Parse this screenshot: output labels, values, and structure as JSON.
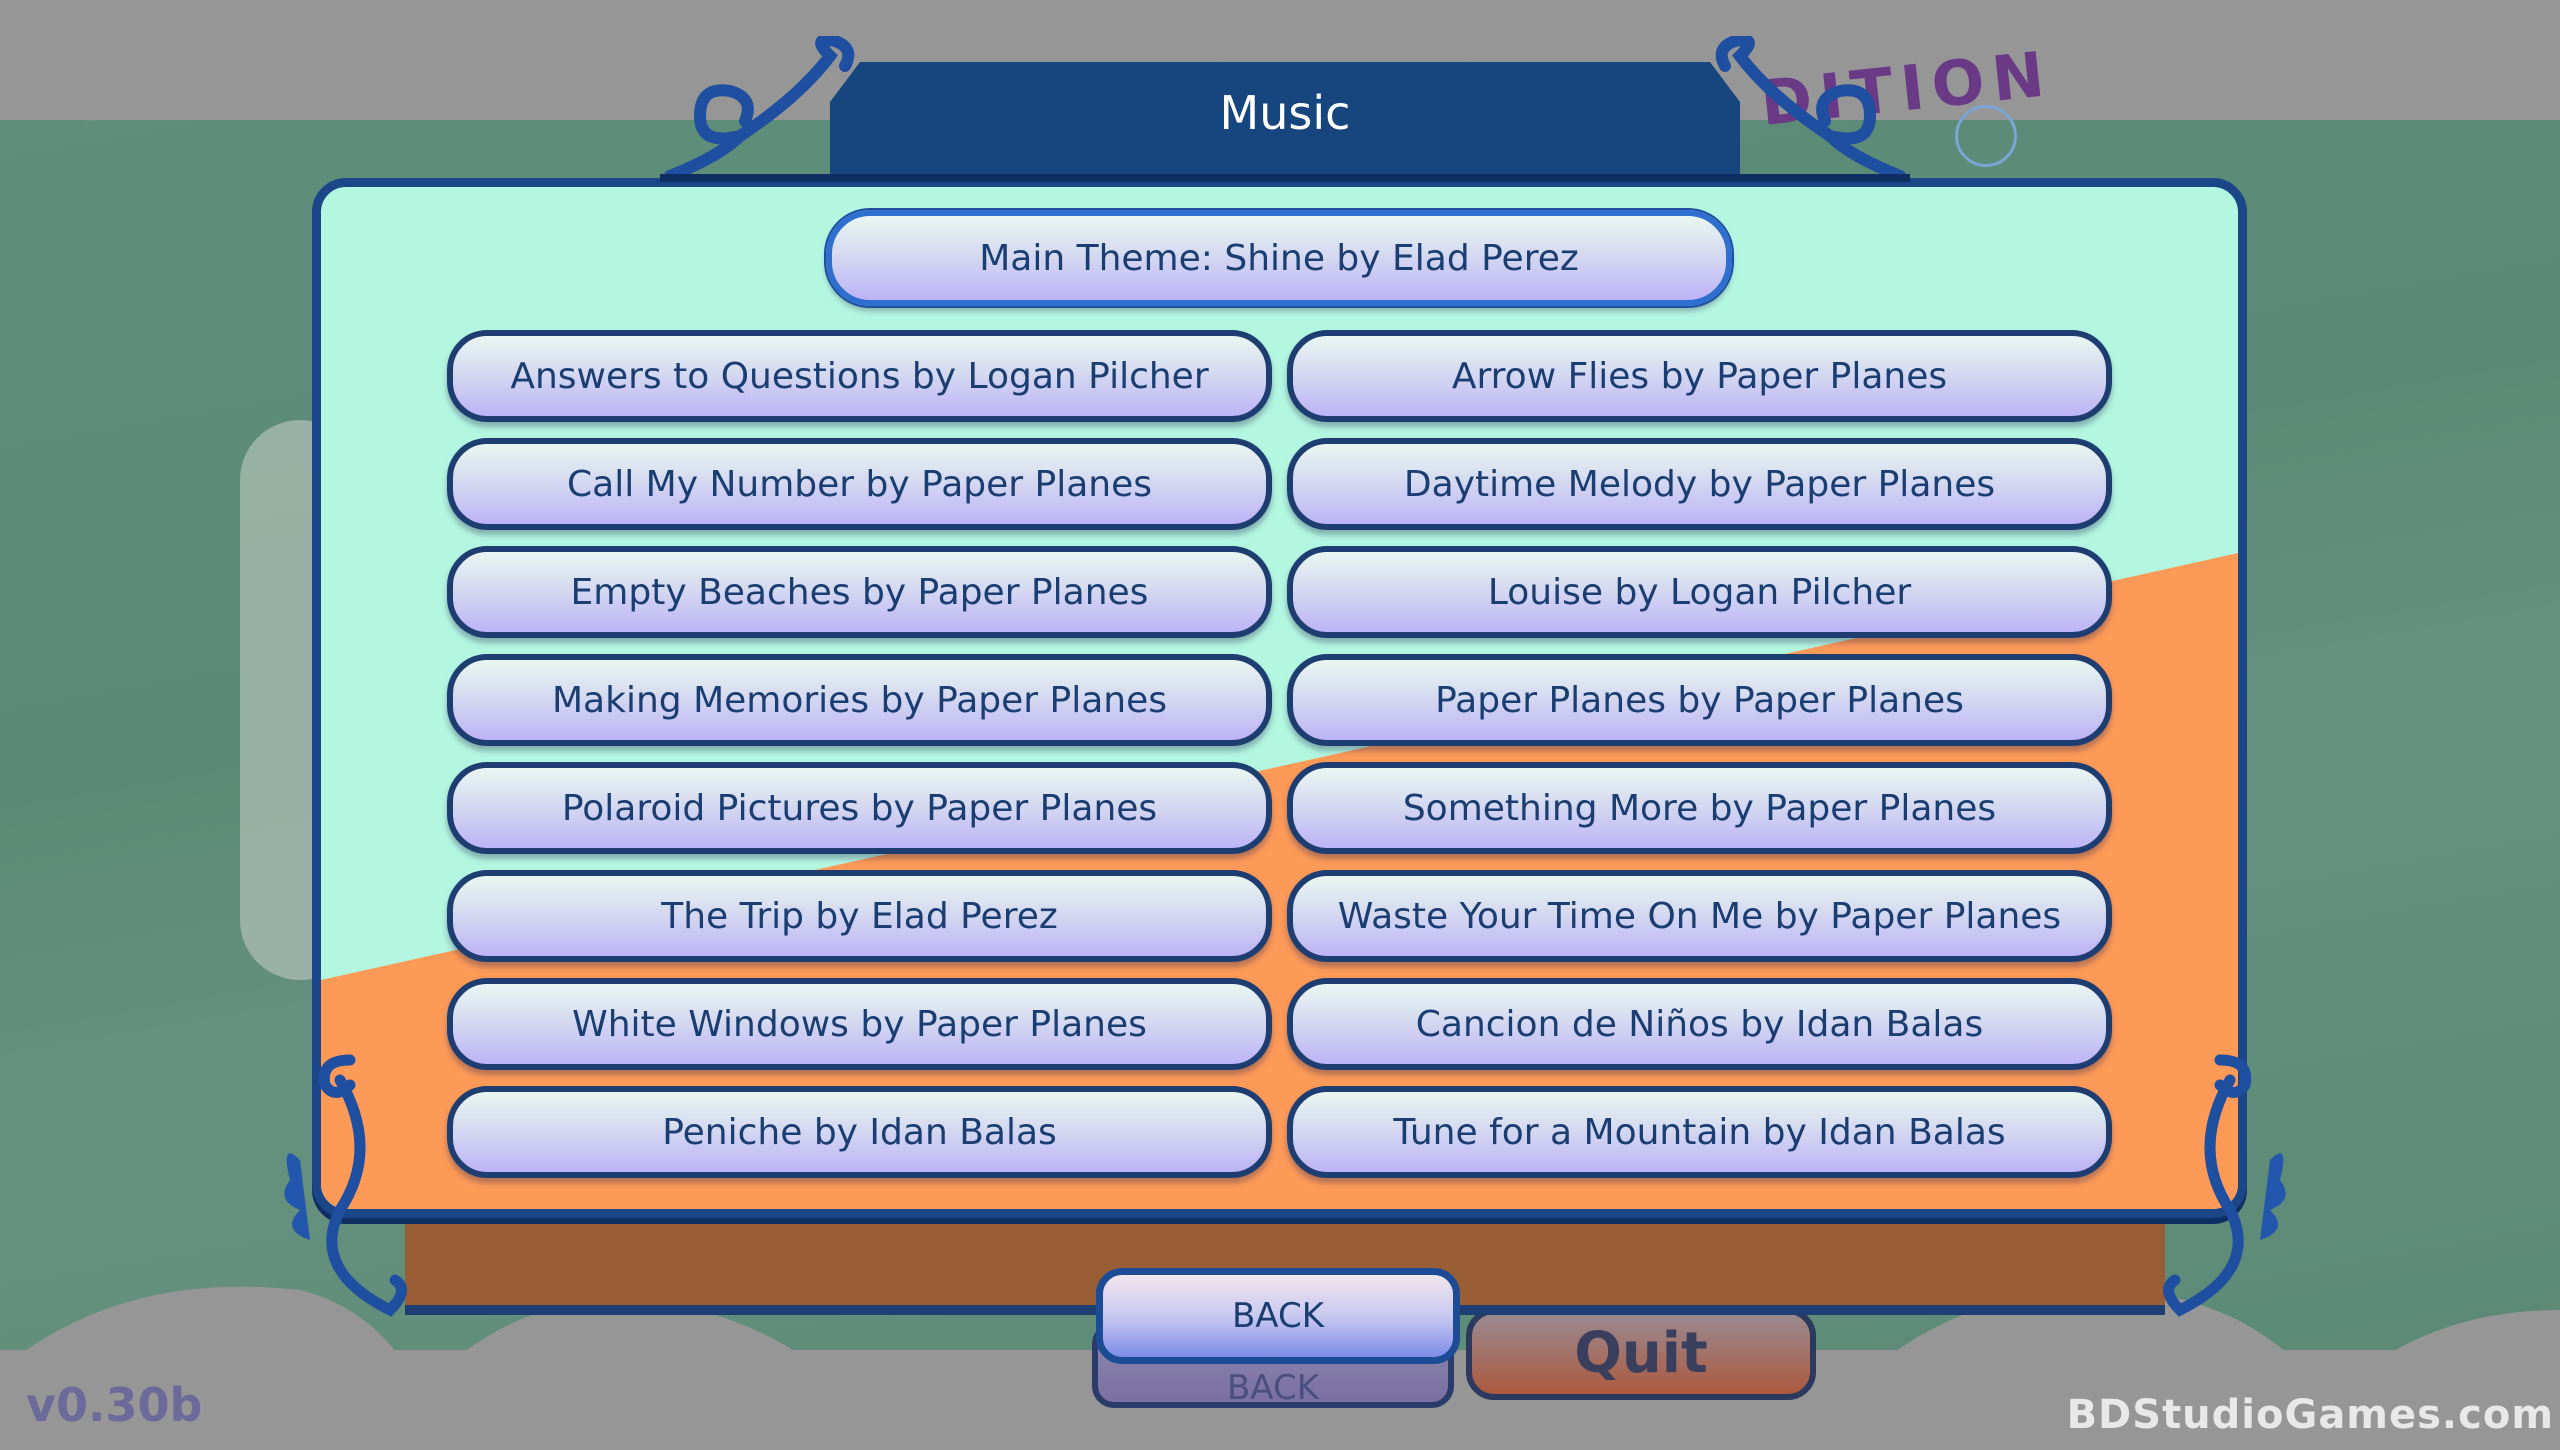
{
  "header": {
    "title": "Music"
  },
  "featured_track": {
    "label": "Main Theme: Shine by Elad Perez",
    "selected": true
  },
  "tracks": [
    {
      "label": "Answers to Questions by Logan Pilcher"
    },
    {
      "label": "Arrow Flies by Paper Planes"
    },
    {
      "label": "Call My Number by Paper Planes"
    },
    {
      "label": "Daytime Melody by Paper Planes"
    },
    {
      "label": "Empty Beaches by Paper Planes"
    },
    {
      "label": "Louise by Logan Pilcher"
    },
    {
      "label": "Making Memories by Paper Planes"
    },
    {
      "label": "Paper Planes by Paper Planes"
    },
    {
      "label": "Polaroid Pictures by Paper Planes"
    },
    {
      "label": "Something More by Paper Planes"
    },
    {
      "label": "The Trip by Elad Perez"
    },
    {
      "label": "Waste Your Time On Me by Paper Planes"
    },
    {
      "label": "White Windows by Paper Planes"
    },
    {
      "label": "Cancion de Niños by Idan Balas"
    },
    {
      "label": "Peniche by Idan Balas"
    },
    {
      "label": "Tune for a Mountain by Idan Balas"
    }
  ],
  "footer": {
    "back_label": "BACK"
  },
  "background": {
    "ghost_back_label": "BACK",
    "quit_label": "Quit",
    "logo_fragment": "DITION",
    "version": "v0.30b"
  },
  "watermark": "BDStudioGames.com",
  "colors": {
    "panel_mint": "#b3f7e1",
    "panel_orange": "#fe9a58",
    "frame_blue": "#1b4789",
    "header_blue": "#17467f",
    "text_navy": "#1a3d72"
  }
}
